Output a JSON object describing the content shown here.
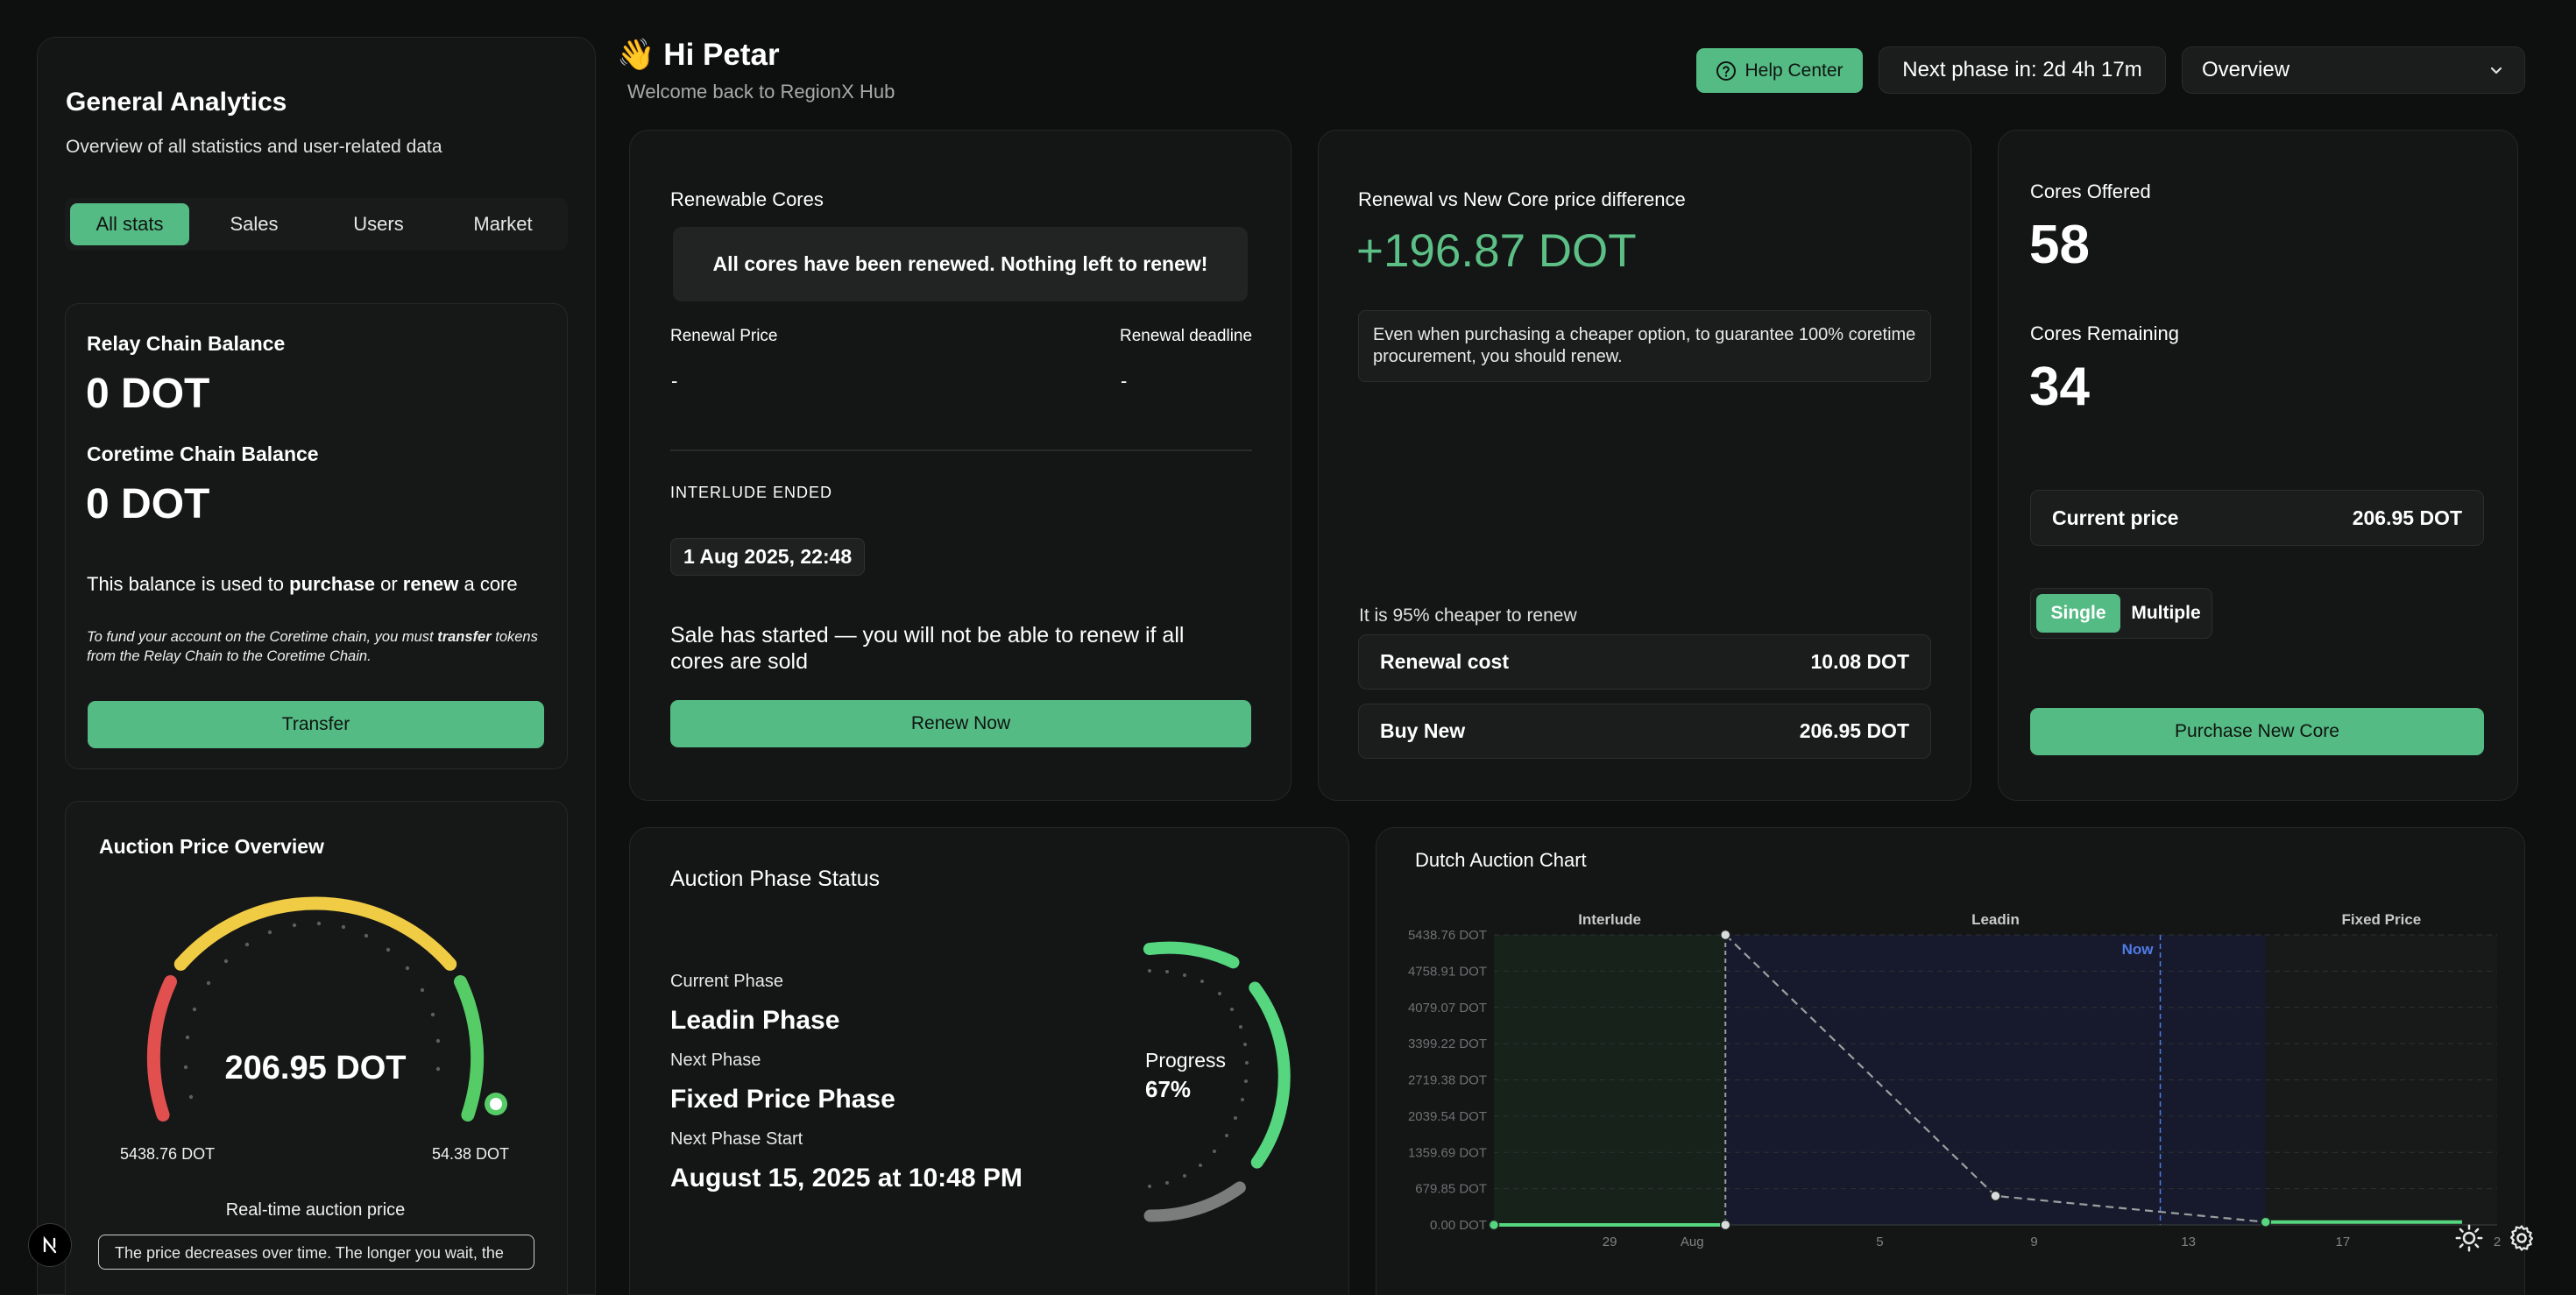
{
  "header": {
    "greeting": "👋 Hi Petar",
    "subtitle": "Welcome back to RegionX Hub",
    "help_label": "Help Center",
    "next_phase": "Next phase in: 2d 4h 17m",
    "view_select": "Overview"
  },
  "sidebar": {
    "title": "General Analytics",
    "subtitle": "Overview of all statistics and user-related data",
    "tabs": [
      "All stats",
      "Sales",
      "Users",
      "Market"
    ],
    "balance": {
      "relay_label": "Relay Chain Balance",
      "relay_value": "0 DOT",
      "coretime_label": "Coretime Chain Balance",
      "coretime_value": "0 DOT",
      "note_pre": "This balance is used to ",
      "note_b1": "purchase",
      "note_mid": " or ",
      "note_b2": "renew",
      "note_post": " a core",
      "fund_pre": "To fund your account on the Coretime chain, you must ",
      "fund_b": "transfer",
      "fund_post": " tokens",
      "fund_line2": "from the Relay Chain to the Coretime Chain.",
      "transfer_label": "Transfer"
    },
    "auction": {
      "title": "Auction Price Overview",
      "price": "206.95 DOT",
      "min_label": "5438.76 DOT",
      "max_label": "54.38 DOT",
      "caption": "Real-time auction price",
      "hint": "The price decreases over time. The longer you wait, the"
    }
  },
  "renewable": {
    "title": "Renewable Cores",
    "banner": "All cores have been renewed. Nothing left to renew!",
    "price_label": "Renewal Price",
    "price_value": "-",
    "deadline_label": "Renewal deadline",
    "deadline_value": "-",
    "interlude_label": "INTERLUDE ENDED",
    "interlude_date": "1 Aug 2025, 22:48",
    "sale_note": "Sale has started — you will not be able to renew if all cores are sold",
    "renew_button": "Renew Now"
  },
  "difference": {
    "title": "Renewal vs New Core price difference",
    "value": "+196.87 DOT",
    "note": "Even when purchasing a cheaper option, to guarantee 100% coretime procurement, you should renew.",
    "cheaper": "It is 95% cheaper to renew",
    "renewal_label": "Renewal cost",
    "renewal_value": "10.08 DOT",
    "buy_label": "Buy New",
    "buy_value": "206.95 DOT"
  },
  "offered": {
    "offered_label": "Cores Offered",
    "offered_value": "58",
    "remaining_label": "Cores Remaining",
    "remaining_value": "34",
    "price_label": "Current price",
    "price_value": "206.95 DOT",
    "mode_single": "Single",
    "mode_multiple": "Multiple",
    "purchase_button": "Purchase New Core"
  },
  "phase": {
    "title": "Auction Phase Status",
    "current_label": "Current Phase",
    "current_value": "Leadin Phase",
    "next_label": "Next Phase",
    "next_value": "Fixed Price Phase",
    "start_label": "Next Phase Start",
    "start_value": "August 15, 2025 at 10:48 PM",
    "progress_label": "Progress",
    "progress_text": "67%",
    "progress": 0.67
  },
  "chart_data": {
    "type": "line",
    "title": "Dutch Auction Chart",
    "regions": [
      "Interlude",
      "Leadin",
      "Fixed Price"
    ],
    "now_label": "Now",
    "y_ticks": [
      "0.00 DOT",
      "679.85 DOT",
      "1359.69 DOT",
      "2039.54 DOT",
      "2719.38 DOT",
      "3399.22 DOT",
      "4079.07 DOT",
      "4758.91 DOT",
      "5438.76 DOT"
    ],
    "ylim": [
      0,
      5438.76
    ],
    "x_ticks": [
      "29",
      "Aug",
      "5",
      "9",
      "13",
      "17",
      "2"
    ],
    "series": [
      {
        "points": [
          {
            "x": "Jul 26",
            "y": 0
          },
          {
            "x": "Aug 1",
            "y": 0
          },
          {
            "x": "Aug 1",
            "y": 5438.76
          },
          {
            "x": "Aug 8",
            "y": 543.88
          },
          {
            "x": "Aug 15",
            "y": 54.38
          },
          {
            "x": "Aug 21",
            "y": 54.38
          }
        ]
      }
    ],
    "grid": true,
    "colors": {
      "line": "#9aa0a0",
      "price": "#55d67f",
      "now": "#4f7be8"
    }
  }
}
